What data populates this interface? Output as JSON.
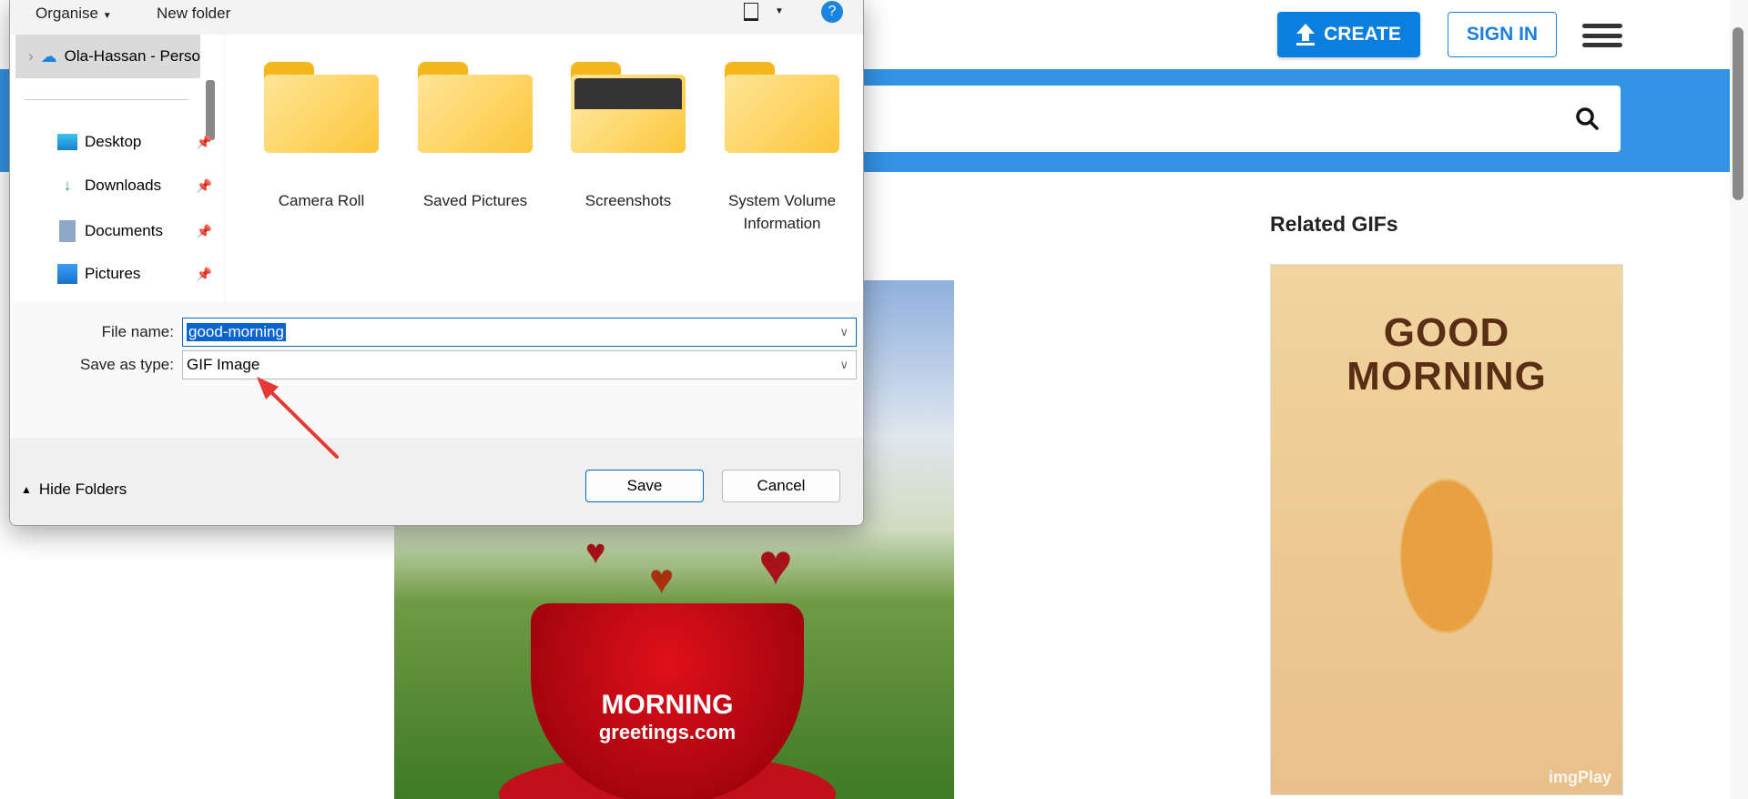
{
  "website": {
    "create_label": "CREATE",
    "signin_label": "SIGN IN",
    "related_title": "Related GIFs",
    "cat_gif": {
      "title_line1": "GOOD",
      "title_line2": "MORNING",
      "watermark": "imgPlay"
    },
    "coffee_gif": {
      "brand_line1": "MORNING",
      "brand_line2": "greetings.com"
    }
  },
  "dialog": {
    "toolbar": {
      "organise": "Organise",
      "new_folder": "New folder",
      "help": "?"
    },
    "nav": {
      "selected": "Ola-Hassan - Personal",
      "items": [
        {
          "label": "Desktop"
        },
        {
          "label": "Downloads"
        },
        {
          "label": "Documents"
        },
        {
          "label": "Pictures"
        }
      ]
    },
    "folders": [
      {
        "name": "Camera Roll"
      },
      {
        "name": "Saved Pictures"
      },
      {
        "name": "Screenshots"
      },
      {
        "name": "System Volume Information"
      }
    ],
    "file_name_label": "File name:",
    "file_name_value": "good-morning",
    "save_type_label": "Save as type:",
    "save_type_value": "GIF Image",
    "hide_folders": "Hide Folders",
    "save": "Save",
    "cancel": "Cancel"
  },
  "colors": {
    "accent": "#0a7fe0",
    "band": "#3393e4",
    "annotation": "#e53935"
  }
}
